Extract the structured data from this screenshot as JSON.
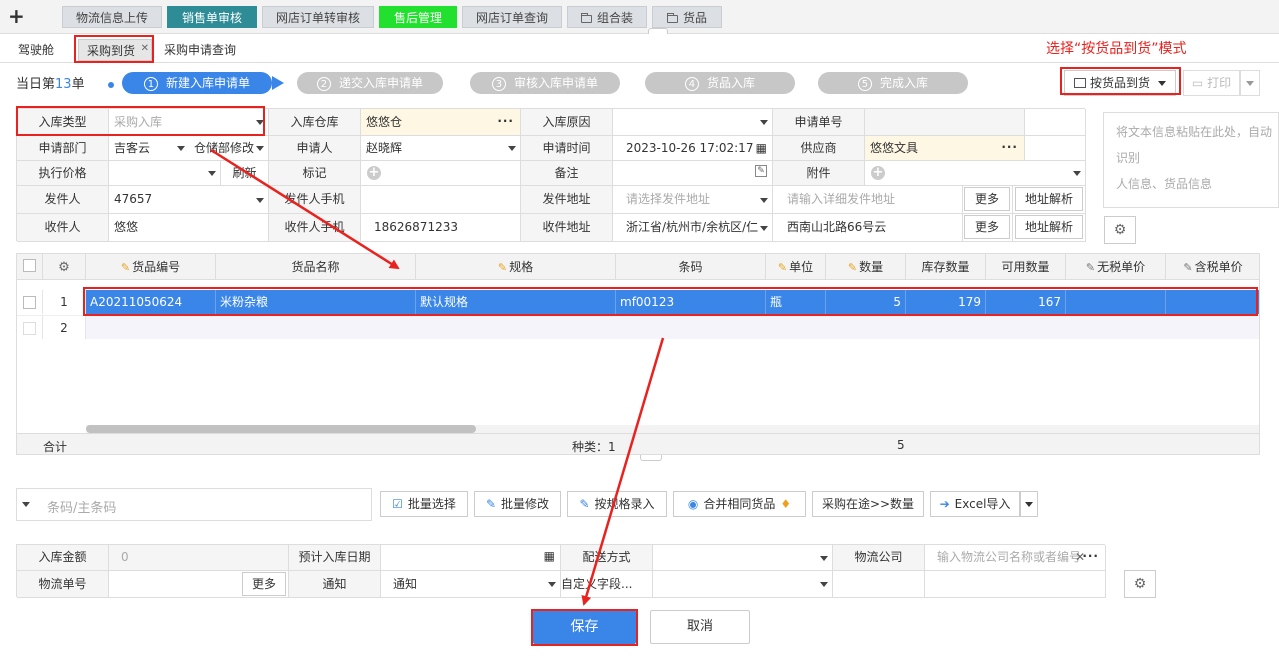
{
  "topbar": {
    "tabs": [
      "物流信息上传",
      "销售单审核",
      "网店订单转审核",
      "售后管理",
      "网店订单查询",
      "组合装",
      "货品"
    ]
  },
  "subtabs": [
    "驾驶舱",
    "采购到货",
    "采购申请查询"
  ],
  "annotation": "选择“按货品到货”模式",
  "today": {
    "prefix": "当日第",
    "num": "13",
    "suffix": "单"
  },
  "steps": [
    {
      "n": "1",
      "label": "新建入库申请单"
    },
    {
      "n": "2",
      "label": "递交入库申请单"
    },
    {
      "n": "3",
      "label": "审核入库申请单"
    },
    {
      "n": "4",
      "label": "货品入库"
    },
    {
      "n": "5",
      "label": "完成入库"
    }
  ],
  "mode_button": "按货品到货",
  "print_button": "打印",
  "form": {
    "labels": {
      "in_type": "入库类型",
      "warehouse": "入库仓库",
      "reason": "入库原因",
      "req_no": "申请单号",
      "dept": "申请部门",
      "applicant": "申请人",
      "time": "申请时间",
      "supplier": "供应商",
      "exec_price": "执行价格",
      "mark": "标记",
      "remark": "备注",
      "attach": "附件",
      "sender": "发件人",
      "sender_phone": "发件人手机",
      "sender_addr": "发件地址",
      "receiver": "收件人",
      "receiver_phone": "收件人手机",
      "receiver_addr": "收件地址"
    },
    "values": {
      "in_type": "采购入库",
      "warehouse": "悠悠仓",
      "dept_a": "吉客云",
      "dept_b": "仓储部修改",
      "applicant": "赵晓辉",
      "time": "2023-10-26 17:02:17",
      "supplier": "悠悠文具",
      "refresh": "刷新",
      "sender": "47657",
      "receiver": "悠悠",
      "receiver_phone": "18626871233",
      "receiver_region": "浙江省/杭州市/余杭区/仁",
      "receiver_detail": "西南山北路66号云"
    },
    "placeholders": {
      "sender_region": "请选择发件地址",
      "sender_detail": "请输入详细发件地址"
    },
    "more": "更多",
    "parse": "地址解析"
  },
  "paste_placeholder": [
    "将文本信息粘贴在此处，自动识别",
    "人信息、货品信息"
  ],
  "grid": {
    "headers": [
      "货品编号",
      "货品名称",
      "规格",
      "条码",
      "单位",
      "数量",
      "库存数量",
      "可用数量",
      "无税单价",
      "含税单价"
    ],
    "rows": [
      {
        "no": "1",
        "code": "A20211050624",
        "name": "米粉杂粮",
        "spec": "默认规格",
        "barcode": "mf00123",
        "unit": "瓶",
        "qty": "5",
        "stock": "179",
        "avail": "167"
      },
      {
        "no": "2"
      }
    ],
    "footer": {
      "total": "合计",
      "kinds": "种类：1",
      "qty": "5"
    }
  },
  "toolbar": {
    "barcode_placeholder": "条码/主条码",
    "buttons": [
      "批量选择",
      "批量修改",
      "按规格录入",
      "合并相同货品",
      "采购在途>>数量",
      "Excel导入"
    ]
  },
  "bottom": {
    "labels": {
      "amount": "入库金额",
      "eta": "预计入库日期",
      "ship": "配送方式",
      "logistics": "物流公司",
      "track": "物流单号",
      "notify": "通知"
    },
    "values": {
      "amount": "0",
      "notify": "通知",
      "custom": "自定义字段..."
    },
    "placeholders": {
      "logistics": "输入物流公司名称或者编号"
    },
    "more": "更多"
  },
  "save": "保存",
  "cancel": "取消"
}
